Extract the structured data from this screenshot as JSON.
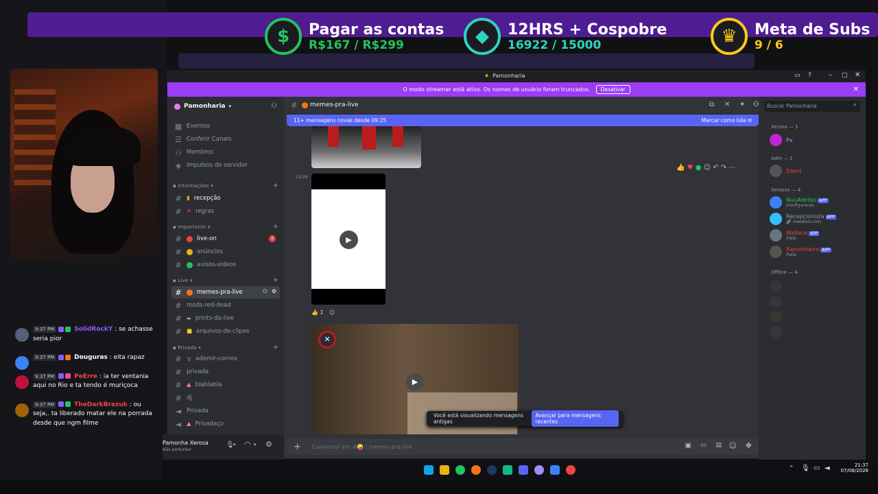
{
  "goals": [
    {
      "title": "Pagar as contas",
      "value": "R$167 / R$299",
      "icon": "dollar-icon",
      "ring_color": "#22c55e",
      "value_color": "#22c55e",
      "progress": 0.558
    },
    {
      "title": "12HRS + Cospobre",
      "value": "16922 / 15000",
      "icon": "diamond-icon",
      "ring_color": "#2dd4bf",
      "value_color": "#2dd4bf",
      "progress": 1.0
    },
    {
      "title": "Meta de Subs",
      "value": "9 / 6",
      "icon": "crown-icon",
      "ring_color": "#facc15",
      "value_color": "#facc15",
      "progress": 1.0
    }
  ],
  "stream_chat": [
    {
      "time": "9:37 PM",
      "user": "SolidRockY",
      "user_color": "#8b5cf6",
      "text": "se achasse seria pior"
    },
    {
      "time": "9:37 PM",
      "user": "Douguras",
      "user_color": "#ffffff",
      "text": "eita rapaz"
    },
    {
      "time": "9:37 PM",
      "user": "PeErre",
      "user_color": "#ef4444",
      "text": "ia ter ventania aqui no Rio e ta tendo é muriçoca"
    },
    {
      "time": "9:37 PM",
      "user": "TheDarkBrazuk",
      "user_color": "#ef4444",
      "text": "ou seja,. ta liberado matar ele na porrada desde que ngm filme"
    }
  ],
  "discord": {
    "window_title": "Pamonharia",
    "streamer_banner": "O modo streamer está ativo. Os nomes de usuário foram truncados.",
    "streamer_button": "Desativar",
    "server_name": "Pamonharia",
    "server_menu": [
      {
        "label": "Eventos",
        "icon": "calendar-icon"
      },
      {
        "label": "Conferir Canais",
        "icon": "channels-icon"
      },
      {
        "label": "Membros",
        "icon": "members-icon"
      },
      {
        "label": "Impulsos de servidor",
        "icon": "boost-icon"
      }
    ],
    "categories": [
      {
        "name": "Informações",
        "channels": [
          {
            "label": "recepção",
            "emoji": "📙",
            "bright": true
          },
          {
            "label": "regras",
            "emoji": "❌",
            "bright": false
          }
        ]
      },
      {
        "name": "Importante",
        "channels": [
          {
            "label": "live-on",
            "emoji": "🔴",
            "bright": true,
            "badge": "2"
          },
          {
            "label": "anúncios",
            "emoji": "🟡",
            "bright": false
          },
          {
            "label": "avisos-videos",
            "emoji": "🟢",
            "bright": false
          }
        ]
      },
      {
        "name": "Live",
        "channels": [
          {
            "label": "memes-pra-live",
            "emoji": "🤪",
            "selected": true
          },
          {
            "label": "mods-red-dead"
          },
          {
            "label": "prints-da-live",
            "emoji": "🖼"
          },
          {
            "label": "arquivos-de-clipes",
            "emoji": "📁"
          }
        ]
      },
      {
        "name": "Privado",
        "channels": [
          {
            "label": "ademir-cornos",
            "emoji": "🐮"
          },
          {
            "label": "privada"
          },
          {
            "label": "blablabla",
            "emoji": "🔺"
          },
          {
            "label": "dj"
          },
          {
            "label": "Privada",
            "voice": true
          },
          {
            "label": "Privadaço",
            "voice": true
          }
        ]
      }
    ],
    "user": {
      "name": "Pamonha Xerosa",
      "status": "Não perturbar"
    },
    "channel_header": "memes-pra-live",
    "new_messages": "11+ mensagens novas desde 09:25",
    "mark_read": "Marcar como lida",
    "message_time": "15:29",
    "reaction_count": "1",
    "old_messages_notice": "Você está visualizando mensagens antigas",
    "jump_button": "Avançar para mensagens recentes",
    "composer_placeholder": "Conversar em #🤪 | memes-pra-live",
    "search_placeholder": "Buscar Pamonharia",
    "member_groups": [
      {
        "title": "Xerosa — 1",
        "members": [
          {
            "name": "Px",
            "color": "#e879f9"
          }
        ]
      },
      {
        "title": "Adm — 1",
        "members": [
          {
            "name": "Silent",
            "color": "#ef4444"
          }
        ]
      },
      {
        "title": "Xerosos — 4",
        "members": [
          {
            "name": "NuuAlertas",
            "color": "#22c55e",
            "app": "APP",
            "sub": "/configuracao"
          },
          {
            "name": "Recepcionista",
            "color": "#949ba4",
            "app": "APP",
            "sub": "🔗 mee6bot.com"
          },
          {
            "name": "Wallace",
            "color": "#ef4444",
            "app": "APP",
            "sub": "/help"
          },
          {
            "name": "Xamonheiro",
            "color": "#ef4444",
            "app": "APP",
            "sub": "/help"
          }
        ]
      },
      {
        "title": "Offline — 4",
        "members": []
      }
    ]
  },
  "taskbar": {
    "time": "21:37",
    "date": "07/08/2026"
  }
}
